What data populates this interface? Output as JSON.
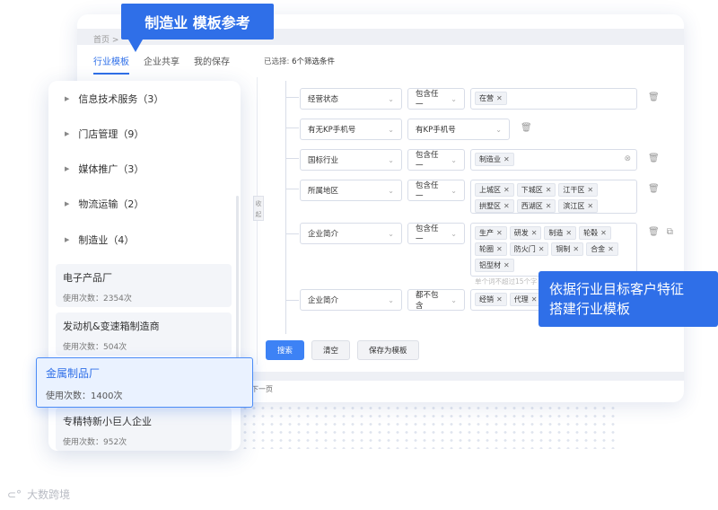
{
  "breadcrumb": "首页  >",
  "tabs": [
    "行业模板",
    "企业共享",
    "我的保存"
  ],
  "selected": {
    "prefix": "已选择:",
    "value": "6个筛选条件"
  },
  "collapse_label": "收起",
  "filters": [
    {
      "field": "经营状态",
      "op": "包含任一",
      "tags": [
        "在营"
      ]
    },
    {
      "field": "有无KP手机号",
      "op": "有KP手机号",
      "tags": []
    },
    {
      "field": "国标行业",
      "op": "包含任一",
      "tags": [
        "制造业"
      ]
    },
    {
      "field": "所属地区",
      "op": "包含任一",
      "tags": [
        "上城区",
        "下城区",
        "江干区",
        "拱墅区",
        "西湖区",
        "滨江区"
      ]
    },
    {
      "field": "企业简介",
      "op": "包含任一",
      "tags": [
        "生产",
        "研发",
        "制造",
        "轮毂",
        "轮圈",
        "防火门",
        "铜制",
        "合金",
        "铝型材"
      ],
      "hint": "单个词不超过15个字"
    },
    {
      "field": "企业简介",
      "op": "都不包含",
      "tags": [
        "经销",
        "代理"
      ]
    }
  ],
  "buttons": {
    "search": "搜索",
    "clear": "清空",
    "save": "保存为模板"
  },
  "pager_next": "下一页",
  "categories": [
    {
      "label": "信息技术服务（3）"
    },
    {
      "label": "门店管理（9）"
    },
    {
      "label": "媒体推广（3）"
    },
    {
      "label": "物流运输（2）"
    },
    {
      "label": "制造业（4）"
    }
  ],
  "templates": [
    {
      "name": "电子产品厂",
      "usage": "使用次数：2354次"
    },
    {
      "name": "发动机&变速箱制造商",
      "usage": "使用次数：504次"
    },
    {
      "name": "金属制品厂",
      "usage": "使用次数：1400次"
    },
    {
      "name": "专精特新小巨人企业",
      "usage": "使用次数：952次"
    }
  ],
  "callout_top": "制造业 模板参考",
  "callout_right": {
    "line1": "依据行业目标客户特征",
    "line2": "搭建行业模板"
  },
  "logo_text": "大数跨境",
  "colors": {
    "accent": "#2f6fe8",
    "highlight_bg": "#eaf2ff"
  }
}
